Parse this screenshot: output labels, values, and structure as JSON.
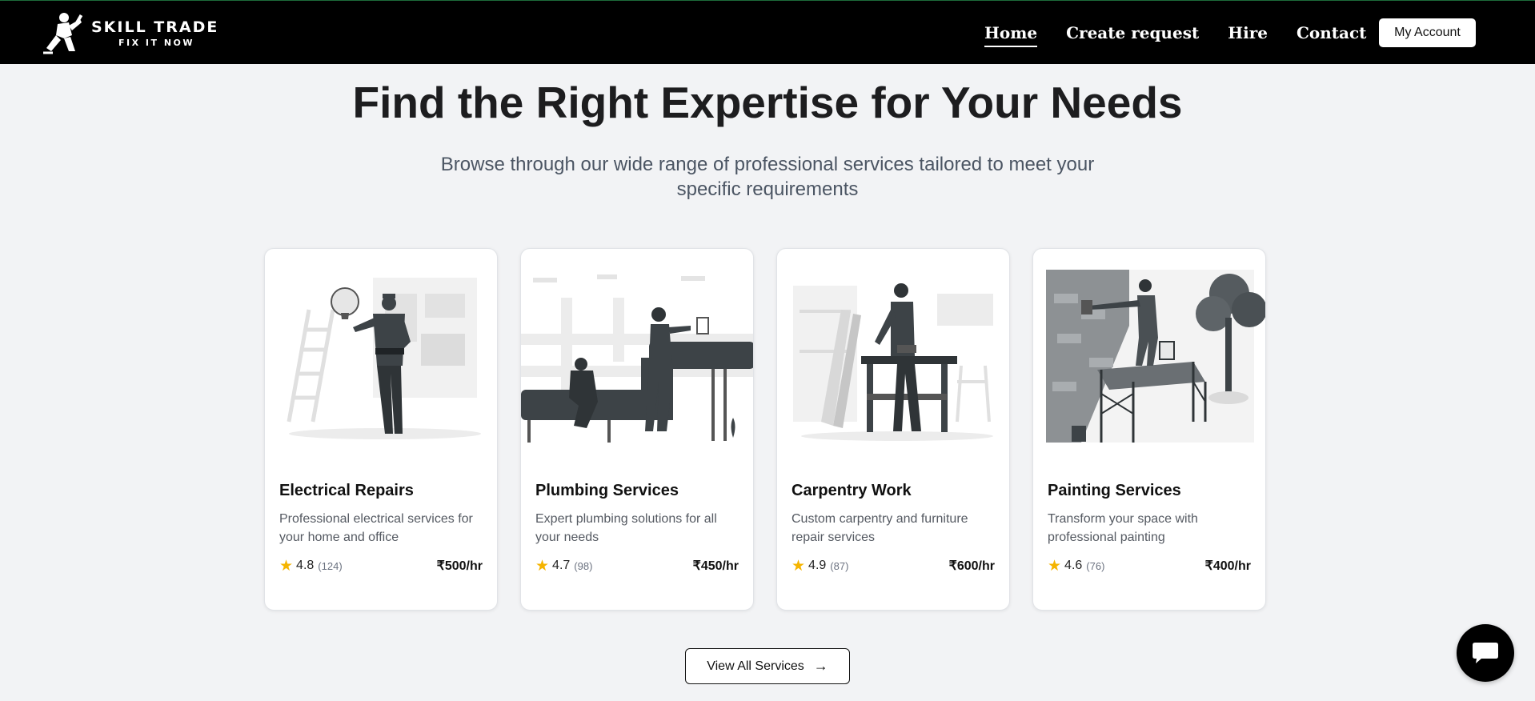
{
  "brand": {
    "name": "SKILL TRADE",
    "tagline": "FIX IT NOW"
  },
  "nav": {
    "links": [
      {
        "label": "Home",
        "active": true
      },
      {
        "label": "Create request",
        "active": false
      },
      {
        "label": "Hire",
        "active": false
      },
      {
        "label": "Contact",
        "active": false
      }
    ],
    "account_label": "My Account"
  },
  "hero": {
    "title": "Find the Right Expertise for Your Needs",
    "subtitle": "Browse through our wide range of professional services tailored to meet your specific requirements"
  },
  "services": [
    {
      "title": "Electrical Repairs",
      "description": "Professional electrical services for your home and office",
      "rating": "4.8",
      "reviews": "(124)",
      "price": "₹500/hr",
      "illustration": "electrician-illustration"
    },
    {
      "title": "Plumbing Services",
      "description": "Expert plumbing solutions for all your needs",
      "rating": "4.7",
      "reviews": "(98)",
      "price": "₹450/hr",
      "illustration": "plumber-illustration"
    },
    {
      "title": "Carpentry Work",
      "description": "Custom carpentry and furniture repair services",
      "rating": "4.9",
      "reviews": "(87)",
      "price": "₹600/hr",
      "illustration": "carpenter-illustration"
    },
    {
      "title": "Painting Services",
      "description": "Transform your space with professional painting",
      "rating": "4.6",
      "reviews": "(76)",
      "price": "₹400/hr",
      "illustration": "painter-illustration"
    }
  ],
  "view_all": {
    "label": "View All Services",
    "icon": "arrow-right-icon"
  },
  "chat": {
    "icon": "chat-bubble-icon"
  },
  "colors": {
    "nav_bg": "#000000",
    "page_bg": "#f2f3f5",
    "star": "#f5b400",
    "text_dark": "#1d1d1f",
    "text_muted": "#4b5563"
  }
}
